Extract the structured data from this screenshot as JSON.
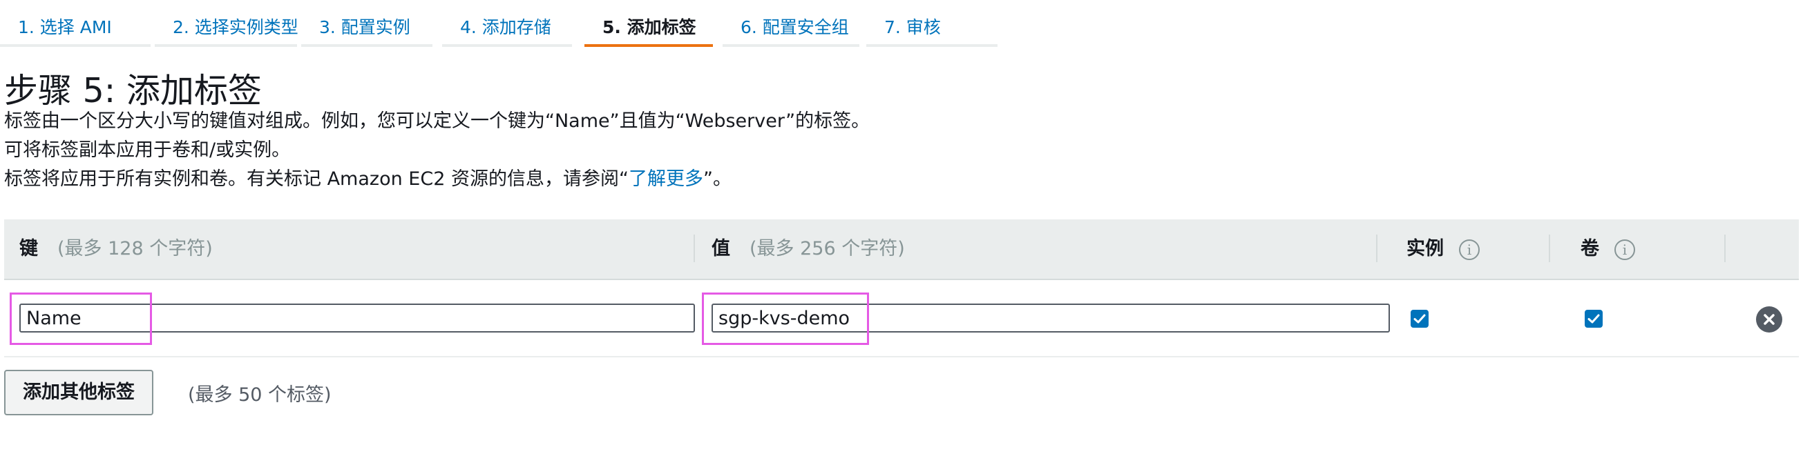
{
  "wizard_tabs": [
    {
      "label": "1. 选择 AMI"
    },
    {
      "label": "2. 选择实例类型"
    },
    {
      "label": "3. 配置实例"
    },
    {
      "label": "4. 添加存储"
    },
    {
      "label": "5. 添加标签"
    },
    {
      "label": "6. 配置安全组"
    },
    {
      "label": "7. 审核"
    }
  ],
  "active_tab": "5. 添加标签",
  "page": {
    "title": "步骤 5: 添加标签",
    "description_line1": "标签由一个区分大小写的键值对组成。例如，您可以定义一个键为“Name”且值为“Webserver”的标签。",
    "description_line2": "可将标签副本应用于卷和/或实例。",
    "description_line3_prefix": "标签将应用于所有实例和卷。有关标记 Amazon EC2 资源的信息，请参阅“",
    "learn_more_link": "了解更多",
    "description_line3_suffix": "”。"
  },
  "table": {
    "headers": {
      "key": "键",
      "key_hint": "(最多 128 个字符)",
      "value": "值",
      "value_hint": "(最多 256 个字符)",
      "instances": "实例",
      "volumes": "卷"
    },
    "rows": [
      {
        "key": "Name",
        "value": "sgp-kvs-demo",
        "instances_checked": true,
        "volumes_checked": true
      }
    ]
  },
  "add_tag_button": "添加其他标签",
  "add_tag_hint": "(最多 50 个标签)",
  "info_icon_glyph": "i",
  "colors": {
    "link": "#0073bb",
    "active_tab_underline": "#ec7211",
    "highlight_box": "#e55ae5",
    "header_bg": "#eaeded"
  }
}
